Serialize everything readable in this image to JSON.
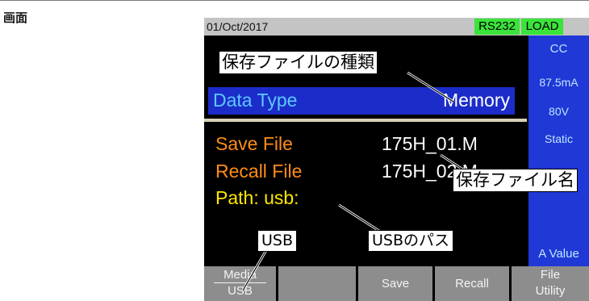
{
  "page_label": "画面",
  "status_bar": {
    "date": "01/Oct/2017",
    "interface_badge": "RS232",
    "mode_badge": "LOAD"
  },
  "main": {
    "data_type_label": "Data Type",
    "data_type_value": "Memory",
    "save_file_label": "Save File",
    "save_file_value": "175H_01.M",
    "recall_file_label": "Recall File",
    "recall_file_value": "175H_02.M",
    "path_label": "Path: usb:"
  },
  "side_panel": {
    "mode": "CC",
    "current": "87.5mA",
    "voltage": "80V",
    "response": "Static",
    "value_type": "A Value"
  },
  "softkeys": {
    "media_label": "Media",
    "media_value": "USB",
    "save": "Save",
    "recall": "Recall",
    "file_utility_line1": "File",
    "file_utility_line2": "Utility"
  },
  "callouts": {
    "data_type": "保存ファイルの種類",
    "file_name": "保存ファイル名",
    "usb": "USB",
    "usb_path": "USBのパス"
  }
}
